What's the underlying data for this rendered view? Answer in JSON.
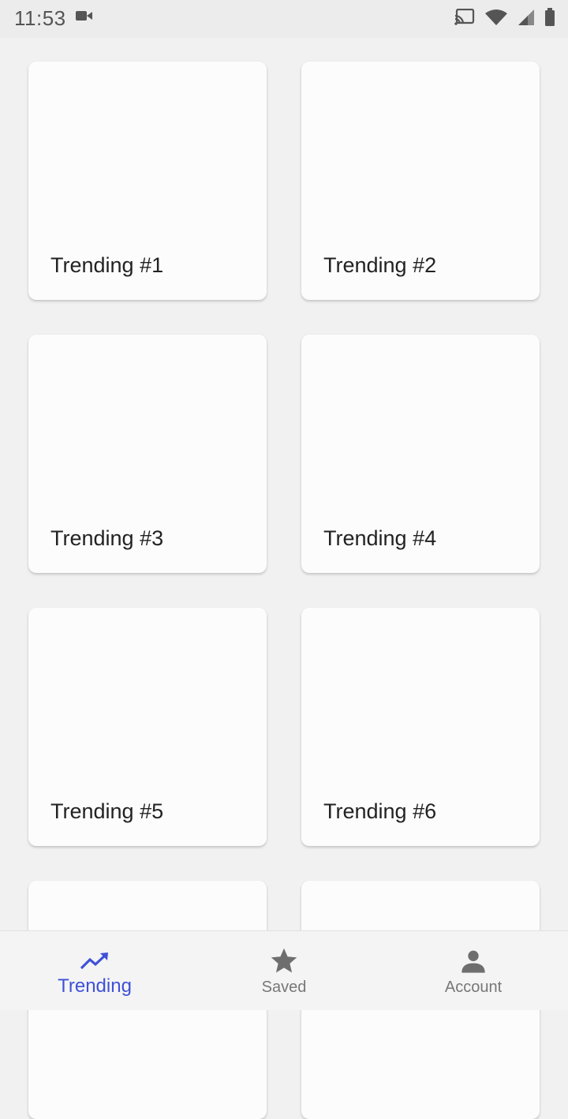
{
  "status_bar": {
    "time": "11:53",
    "icons": [
      "video-camera-icon",
      "cast-icon",
      "wifi-icon",
      "signal-icon",
      "battery-icon"
    ]
  },
  "cards": [
    {
      "title": "Trending #1"
    },
    {
      "title": "Trending #2"
    },
    {
      "title": "Trending #3"
    },
    {
      "title": "Trending #4"
    },
    {
      "title": "Trending #5"
    },
    {
      "title": "Trending #6"
    },
    {
      "title": ""
    },
    {
      "title": ""
    }
  ],
  "bottom_nav": {
    "active_color": "#3f51d8",
    "inactive_color": "#777777",
    "items": [
      {
        "label": "Trending",
        "icon": "trending-up-icon",
        "active": true
      },
      {
        "label": "Saved",
        "icon": "star-icon",
        "active": false
      },
      {
        "label": "Account",
        "icon": "person-icon",
        "active": false
      }
    ]
  }
}
